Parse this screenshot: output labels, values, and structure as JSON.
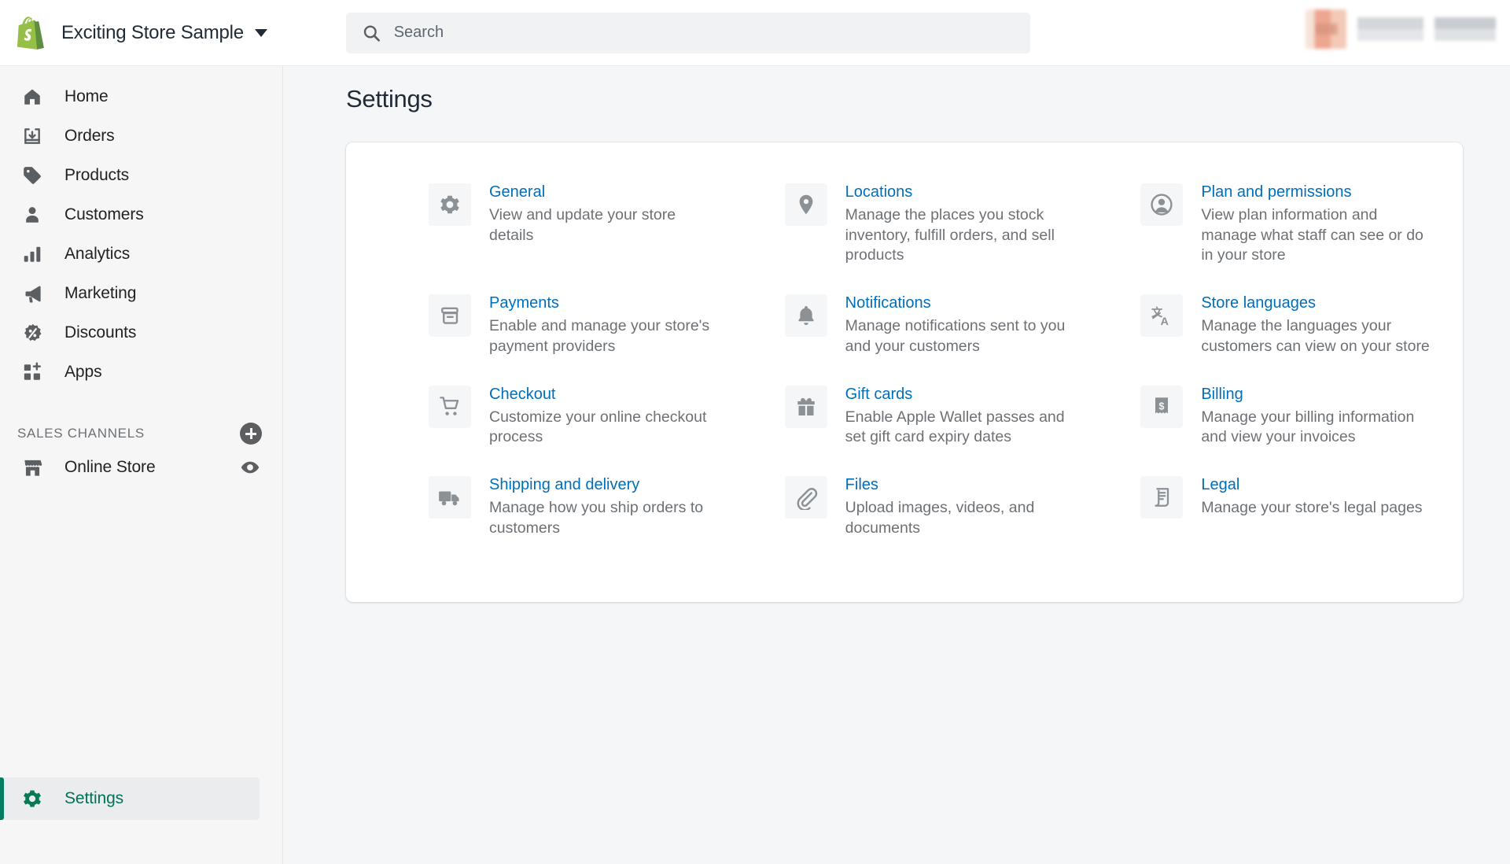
{
  "topbar": {
    "store_name": "Exciting Store Sample",
    "store_caret_icon": "chevron-down-icon",
    "logo_icon": "shopify-bag-logo",
    "search": {
      "value": "",
      "placeholder": "Search",
      "icon": "search-icon"
    },
    "user": {
      "avatar_icon": "avatar-blurred",
      "name_redacted": "",
      "role_redacted": ""
    }
  },
  "sidebar": {
    "items": [
      {
        "label": "Home",
        "icon": "home-icon"
      },
      {
        "label": "Orders",
        "icon": "orders-inbox-icon"
      },
      {
        "label": "Products",
        "icon": "products-tag-icon"
      },
      {
        "label": "Customers",
        "icon": "customers-person-icon"
      },
      {
        "label": "Analytics",
        "icon": "analytics-bars-icon"
      },
      {
        "label": "Marketing",
        "icon": "marketing-megaphone-icon"
      },
      {
        "label": "Discounts",
        "icon": "discounts-percent-icon"
      },
      {
        "label": "Apps",
        "icon": "apps-grid-plus-icon"
      }
    ],
    "sales_channels": {
      "title": "SALES CHANNELS",
      "add_icon": "circle-plus-icon",
      "channels": [
        {
          "label": "Online Store",
          "icon": "storefront-icon",
          "action_icon": "eye-icon"
        }
      ]
    },
    "settings": {
      "label": "Settings",
      "icon": "gear-icon",
      "active": true,
      "accent": "#00725a"
    }
  },
  "main": {
    "page_title": "Settings",
    "accent_link_color": "#006fbb",
    "settings": [
      {
        "title": "General",
        "desc": "View and update your store details",
        "icon": "gear-icon"
      },
      {
        "title": "Locations",
        "desc": "Manage the places you stock inventory, fulfill orders, and sell products",
        "icon": "location-pin-icon"
      },
      {
        "title": "Plan and permissions",
        "desc": "View plan information and manage what staff can see or do in your store",
        "icon": "person-circle-icon"
      },
      {
        "title": "Payments",
        "desc": "Enable and manage your store's payment providers",
        "icon": "credit-card-icon"
      },
      {
        "title": "Notifications",
        "desc": "Manage notifications sent to you and your customers",
        "icon": "bell-icon"
      },
      {
        "title": "Store languages",
        "desc": "Manage the languages your customers can view on your store",
        "icon": "translate-icon"
      },
      {
        "title": "Checkout",
        "desc": "Customize your online checkout process",
        "icon": "shopping-cart-icon"
      },
      {
        "title": "Gift cards",
        "desc": "Enable Apple Wallet passes and set gift card expiry dates",
        "icon": "gift-box-icon"
      },
      {
        "title": "Billing",
        "desc": "Manage your billing information and view your invoices",
        "icon": "receipt-dollar-icon"
      },
      {
        "title": "Shipping and delivery",
        "desc": "Manage how you ship orders to customers",
        "icon": "delivery-truck-icon"
      },
      {
        "title": "Files",
        "desc": "Upload images, videos, and documents",
        "icon": "paperclip-icon"
      },
      {
        "title": "Legal",
        "desc": "Manage your store's legal pages",
        "icon": "scroll-document-icon"
      }
    ]
  }
}
